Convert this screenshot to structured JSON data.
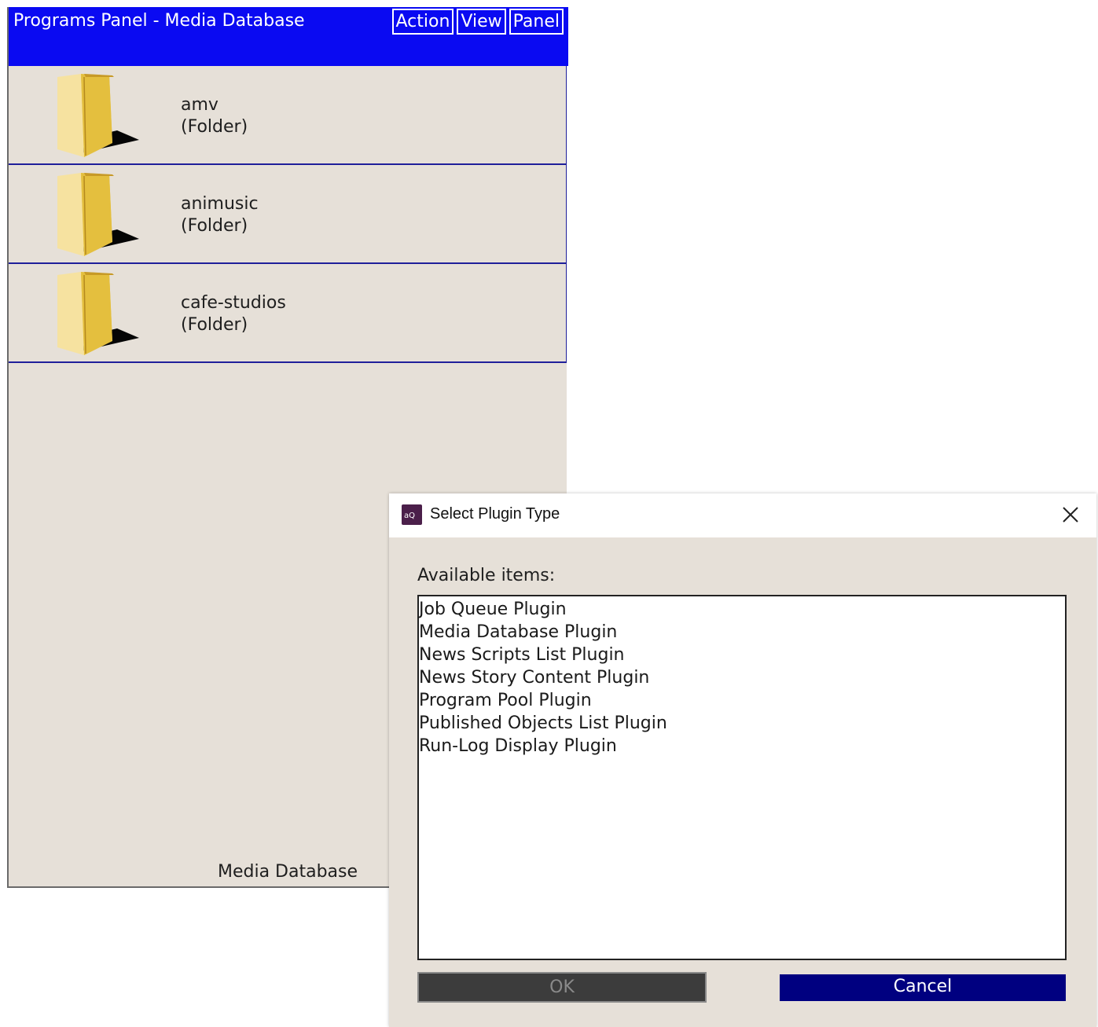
{
  "panel": {
    "title": "Programs Panel - Media Database",
    "menu": [
      "Action",
      "View",
      "Panel"
    ],
    "folders": [
      {
        "name": "amv",
        "type": "(Folder)"
      },
      {
        "name": "animusic",
        "type": "(Folder)"
      },
      {
        "name": "cafe-studios",
        "type": "(Folder)"
      }
    ],
    "footer": "Media Database",
    "icon": "folder-icon"
  },
  "dialog": {
    "title": "Select Plugin Type",
    "app_icon": "app-logo-icon",
    "close_icon": "close-icon",
    "list_label": "Available items:",
    "items": [
      "Job Queue Plugin",
      "Media Database Plugin",
      "News Scripts List Plugin",
      "News Story Content Plugin",
      "Program Pool Plugin",
      "Published Objects List Plugin",
      "Run-Log Display Plugin"
    ],
    "ok_label": "OK",
    "ok_enabled": false,
    "cancel_label": "Cancel"
  },
  "colors": {
    "header_blue": "#0a0af2",
    "panel_bg": "#e6e0d8",
    "cancel_bg": "#000080",
    "ok_disabled_bg": "#3c3c3c"
  }
}
